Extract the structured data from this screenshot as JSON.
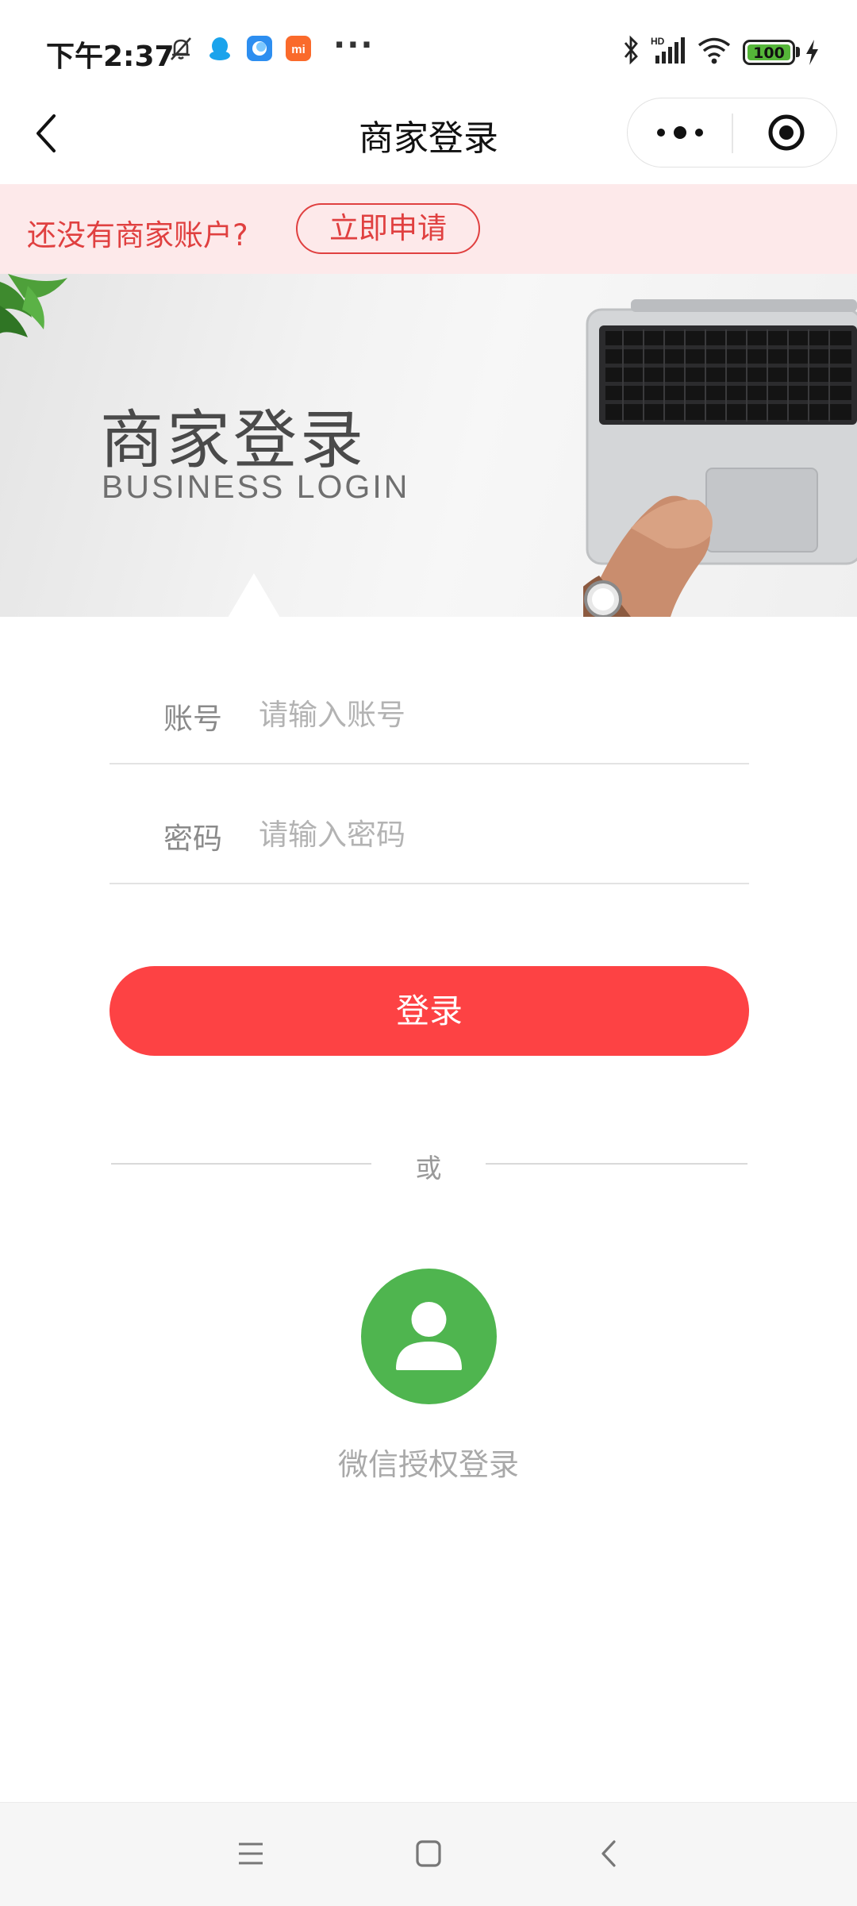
{
  "status_bar": {
    "time": "下午2:37",
    "battery": "100",
    "icons": [
      "bell-off-icon",
      "qq-icon",
      "app-icon",
      "mi-icon",
      "more-dots-icon",
      "bluetooth-icon",
      "hd-signal-icon",
      "wifi-icon",
      "battery-icon",
      "charging-icon"
    ],
    "more_dots": "···",
    "hd": "HD"
  },
  "navbar": {
    "title": "商家登录",
    "icons": [
      "back-icon",
      "more-menu-icon",
      "record-target-icon"
    ]
  },
  "apply_bar": {
    "text": "还没有商家账户?",
    "button": "立即申请"
  },
  "hero": {
    "title": "商家登录",
    "subtitle": "BUSINESS LOGIN"
  },
  "form": {
    "account_label": "账号",
    "account_placeholder": "请输入账号",
    "account_value": "",
    "password_label": "密码",
    "password_placeholder": "请输入密码",
    "password_value": "",
    "login_button": "登录"
  },
  "divider": {
    "text": "或"
  },
  "wechat": {
    "label": "微信授权登录",
    "icon": "user-icon"
  },
  "colors": {
    "accent": "#fd4244",
    "apply_text": "#e04040",
    "apply_bg": "#fde9ea",
    "wechat_green": "#4fb54f"
  }
}
